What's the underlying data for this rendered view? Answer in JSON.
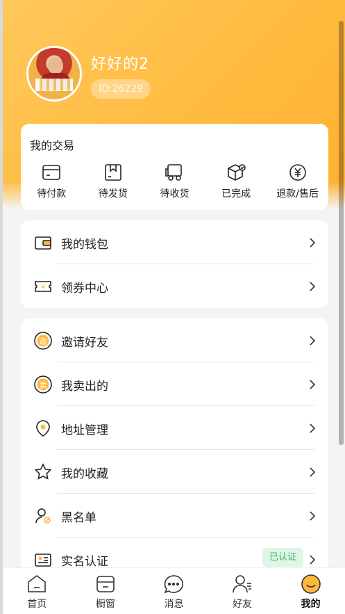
{
  "profile": {
    "name": "好好的2",
    "id_text": "ID:26229",
    "avatar_icon": "avatar"
  },
  "trade": {
    "title": "我的交易",
    "items": [
      {
        "label": "待付款",
        "icon": "wallet-card-icon"
      },
      {
        "label": "待发货",
        "icon": "box-icon"
      },
      {
        "label": "待收货",
        "icon": "truck-icon"
      },
      {
        "label": "已完成",
        "icon": "package-check-icon"
      },
      {
        "label": "退款/售后",
        "icon": "yen-icon"
      }
    ]
  },
  "menu1": [
    {
      "label": "我的钱包",
      "icon": "wallet-icon"
    },
    {
      "label": "领券中心",
      "icon": "coupon-icon"
    }
  ],
  "menu2": [
    {
      "label": "邀请好友",
      "icon": "invite-icon"
    },
    {
      "label": "我卖出的",
      "icon": "sold-icon"
    },
    {
      "label": "地址管理",
      "icon": "location-icon"
    },
    {
      "label": "我的收藏",
      "icon": "star-icon"
    },
    {
      "label": "黑名单",
      "icon": "blacklist-icon"
    },
    {
      "label": "实名认证",
      "icon": "id-card-icon",
      "badge": "已认证"
    }
  ],
  "tabs": [
    {
      "label": "首页",
      "icon": "home-icon"
    },
    {
      "label": "橱窗",
      "icon": "shop-icon"
    },
    {
      "label": "消息",
      "icon": "message-icon"
    },
    {
      "label": "好友",
      "icon": "friends-icon"
    },
    {
      "label": "我的",
      "icon": "me-icon",
      "active": true
    }
  ],
  "colors": {
    "accent": "#ffb83a",
    "badge_bg": "#dff5e6",
    "badge_text": "#3cb46a"
  }
}
